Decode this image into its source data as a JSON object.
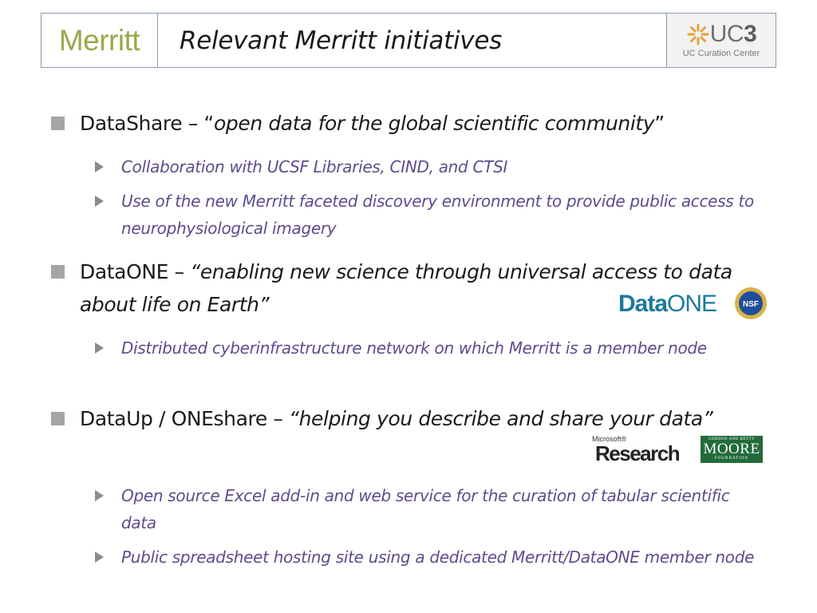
{
  "header": {
    "merritt_logo": "Merritt",
    "title": "Relevant Merritt initiatives",
    "uc3_logo": "UC",
    "uc3_digit": "3",
    "uc3_sub": "UC Curation Center"
  },
  "bullets": [
    {
      "lead": "DataShare – “",
      "quote": "open data for the global scientific community",
      "tail": "”",
      "subs": [
        "Collaboration with UCSF Libraries, CIND, and CTSI",
        "Use of the new Merritt faceted discovery environment to provide public access to neurophysiological imagery"
      ]
    },
    {
      "lead": "DataONE – ",
      "quote": "“enabling new science through universal access to data about life on Earth”",
      "tail": "",
      "subs": [
        "Distributed cyberinfrastructure network on which Merritt is a member node"
      ]
    },
    {
      "lead": "DataUp / ONEshare – ",
      "quote": "“helping you describe and share your data”",
      "tail": "",
      "subs": [
        "Open source Excel add-in and web service for the curation of tabular scientific data",
        "Public spreadsheet hosting site using a dedicated Merritt/DataONE member node"
      ]
    }
  ],
  "logos": {
    "dataone_a": "Data",
    "dataone_b": "ONE",
    "nsf": "NSF",
    "msr_small": "Microsoft®",
    "msr_big": "Research",
    "moore_top": "GORDON AND BETTY",
    "moore_mid": "MOORE",
    "moore_bot": "FOUNDATION"
  },
  "colors": {
    "bullet_text": "#1a1a1a",
    "sub_text": "#5f4b8b",
    "merritt_green": "#9aa84a",
    "dataone_blue": "#1c7a9c",
    "moore_green": "#226b3b"
  }
}
